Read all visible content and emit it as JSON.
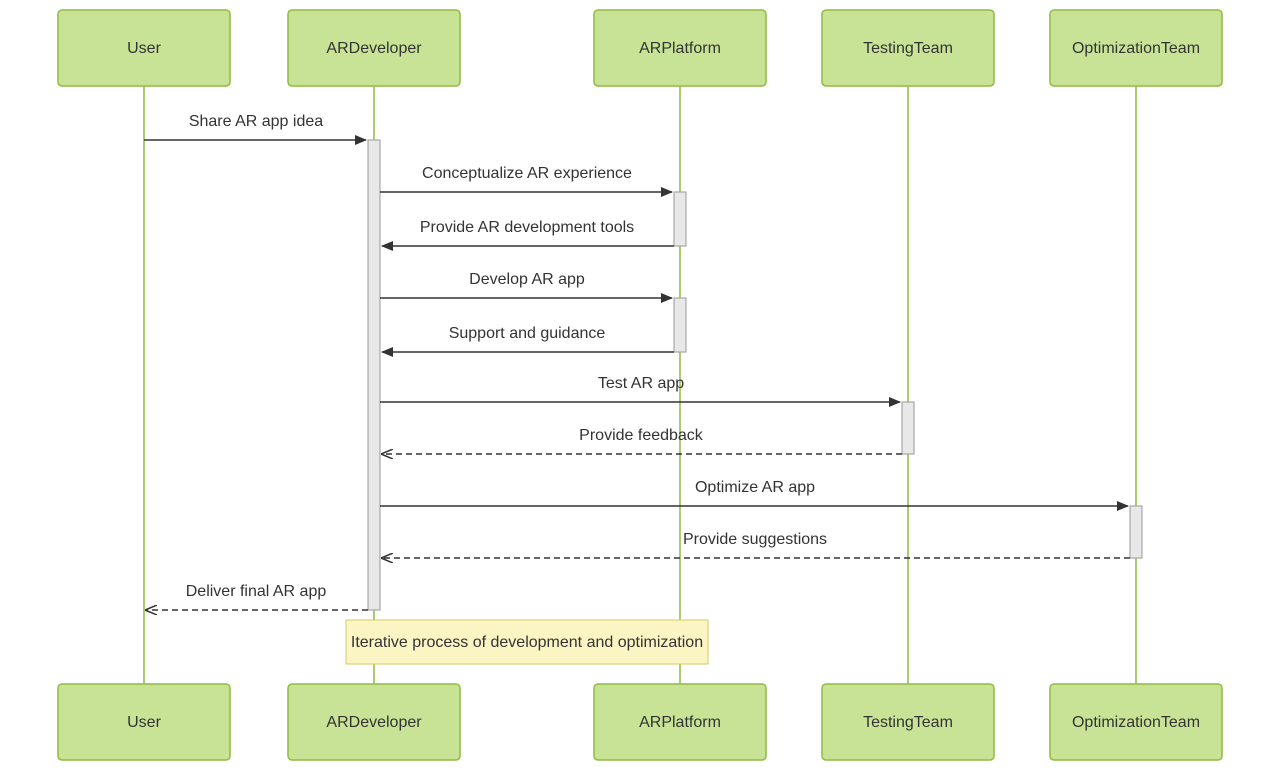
{
  "diagram": {
    "type": "sequence",
    "actors": [
      {
        "id": "user",
        "label": "User"
      },
      {
        "id": "ardev",
        "label": "ARDeveloper"
      },
      {
        "id": "arplat",
        "label": "ARPlatform"
      },
      {
        "id": "testing",
        "label": "TestingTeam"
      },
      {
        "id": "opt",
        "label": "OptimizationTeam"
      }
    ],
    "messages": [
      {
        "from": "user",
        "to": "ardev",
        "label": "Share AR app idea",
        "style": "solid"
      },
      {
        "from": "ardev",
        "to": "arplat",
        "label": "Conceptualize AR experience",
        "style": "solid"
      },
      {
        "from": "arplat",
        "to": "ardev",
        "label": "Provide AR development tools",
        "style": "solid"
      },
      {
        "from": "ardev",
        "to": "arplat",
        "label": "Develop AR app",
        "style": "solid"
      },
      {
        "from": "arplat",
        "to": "ardev",
        "label": "Support and guidance",
        "style": "solid"
      },
      {
        "from": "ardev",
        "to": "testing",
        "label": "Test AR app",
        "style": "solid"
      },
      {
        "from": "testing",
        "to": "ardev",
        "label": "Provide feedback",
        "style": "dashed"
      },
      {
        "from": "ardev",
        "to": "opt",
        "label": "Optimize AR app",
        "style": "solid"
      },
      {
        "from": "opt",
        "to": "ardev",
        "label": "Provide suggestions",
        "style": "dashed"
      },
      {
        "from": "ardev",
        "to": "user",
        "label": "Deliver final AR app",
        "style": "dashed"
      }
    ],
    "note": {
      "over": "ardev",
      "label": "Iterative process of development and optimization"
    }
  }
}
